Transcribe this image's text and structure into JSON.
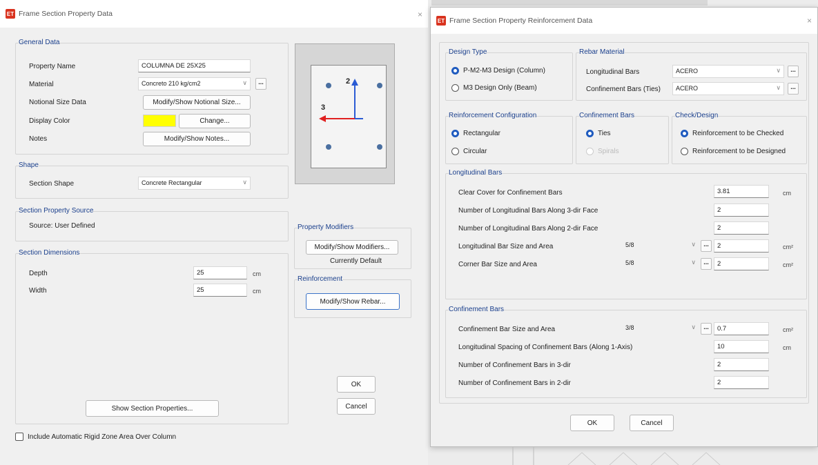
{
  "left_dialog": {
    "title": "Frame Section Property Data",
    "close_glyph": "×",
    "general_data": {
      "group_label": "General Data",
      "property_name_label": "Property Name",
      "property_name_value": "COLUMNA DE 25X25",
      "material_label": "Material",
      "material_value": "Concreto 210 kg/cm2",
      "notional_label": "Notional Size Data",
      "notional_button": "Modify/Show Notional Size...",
      "display_color_label": "Display Color",
      "display_color_swatch": "#ffff00",
      "change_button": "Change...",
      "notes_label": "Notes",
      "notes_button": "Modify/Show Notes..."
    },
    "shape": {
      "group_label": "Shape",
      "section_shape_label": "Section Shape",
      "section_shape_value": "Concrete Rectangular"
    },
    "source": {
      "group_label": "Section Property Source",
      "source_text": "Source:  User Defined"
    },
    "dimensions": {
      "group_label": "Section Dimensions",
      "depth_label": "Depth",
      "depth_value": "25",
      "depth_unit": "cm",
      "width_label": "Width",
      "width_value": "25",
      "width_unit": "cm"
    },
    "preview": {
      "axis_2": "2",
      "axis_3": "3"
    },
    "property_modifiers": {
      "group_label": "Property Modifiers",
      "button": "Modify/Show Modifiers...",
      "status": "Currently Default"
    },
    "reinforcement": {
      "group_label": "Reinforcement",
      "button": "Modify/Show Rebar..."
    },
    "show_section_properties_button": "Show Section Properties...",
    "ok_button": "OK",
    "cancel_button": "Cancel",
    "rigid_zone_checkbox": "Include Automatic Rigid Zone Area Over Column"
  },
  "right_dialog": {
    "title": "Frame Section Property Reinforcement Data",
    "close_glyph": "×",
    "design_type": {
      "group_label": "Design Type",
      "option_column": "P-M2-M3 Design  (Column)",
      "option_beam": "M3 Design Only  (Beam)"
    },
    "rebar_material": {
      "group_label": "Rebar Material",
      "longitudinal_label": "Longitudinal Bars",
      "longitudinal_value": "ACERO",
      "confinement_label": "Confinement Bars (Ties)",
      "confinement_value": "ACERO"
    },
    "reinforcement_config": {
      "group_label": "Reinforcement Configuration",
      "option_rectangular": "Rectangular",
      "option_circular": "Circular"
    },
    "confinement_type": {
      "group_label": "Confinement Bars",
      "option_ties": "Ties",
      "option_spirals": "Spirals"
    },
    "check_design": {
      "group_label": "Check/Design",
      "option_checked": "Reinforcement to be Checked",
      "option_designed": "Reinforcement to be Designed"
    },
    "longitudinal_bars": {
      "group_label": "Longitudinal Bars",
      "clear_cover_label": "Clear Cover for Confinement Bars",
      "clear_cover_value": "3.81",
      "clear_cover_unit": "cm",
      "bars_3dir_label": "Number of Longitudinal Bars Along 3-dir Face",
      "bars_3dir_value": "2",
      "bars_2dir_label": "Number of Longitudinal Bars Along 2-dir Face",
      "bars_2dir_value": "2",
      "bar_size_label": "Longitudinal Bar Size and Area",
      "bar_size_value": "5/8",
      "bar_area_value": "2",
      "bar_area_unit": "cm²",
      "corner_label": "Corner Bar Size and Area",
      "corner_size_value": "5/8",
      "corner_area_value": "2",
      "corner_area_unit": "cm²"
    },
    "confinement_bars": {
      "group_label": "Confinement Bars",
      "size_label": "Confinement Bar Size and Area",
      "size_value": "3/8",
      "area_value": "0.7",
      "area_unit": "cm²",
      "spacing_label": "Longitudinal Spacing of Confinement Bars  (Along 1-Axis)",
      "spacing_value": "10",
      "spacing_unit": "cm",
      "num_3dir_label": "Number of Confinement Bars in 3-dir",
      "num_3dir_value": "2",
      "num_2dir_label": "Number of Confinement Bars in 2-dir",
      "num_2dir_value": "2"
    },
    "ok_button": "OK",
    "cancel_button": "Cancel"
  },
  "icons": {
    "app_icon": "ET",
    "dropdown": "∨",
    "ellipsis": "..."
  }
}
